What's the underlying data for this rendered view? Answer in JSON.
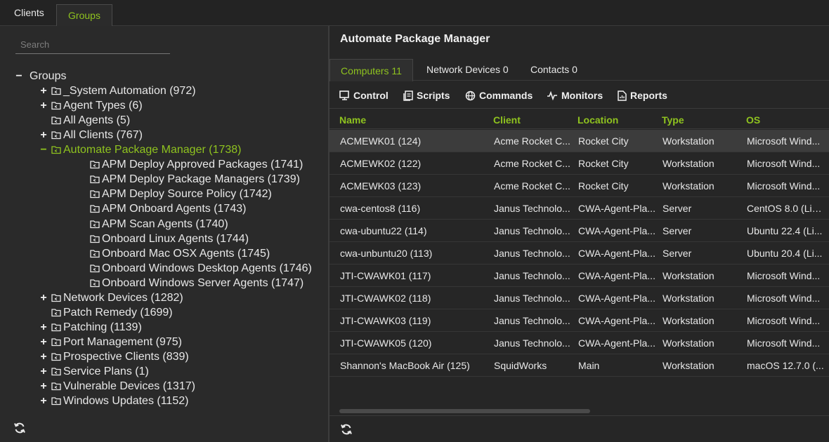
{
  "top_tabs": {
    "clients": "Clients",
    "groups": "Groups"
  },
  "search": {
    "placeholder": "Search",
    "value": ""
  },
  "colors": {
    "accent": "#8fc31f",
    "background": "#2a2a2a",
    "selected_row": "#3c3c3c"
  },
  "tree": {
    "root": {
      "toggle": "−",
      "label": "Groups"
    },
    "items": [
      {
        "toggle": "+",
        "label": "_System Automation (972)"
      },
      {
        "toggle": "+",
        "label": "Agent Types (6)"
      },
      {
        "toggle": "",
        "label": "All Agents (5)"
      },
      {
        "toggle": "+",
        "label": "All Clients (767)"
      },
      {
        "toggle": "−",
        "label": "Automate Package Manager (1738)",
        "selected": true
      },
      {
        "toggle": "",
        "label": "APM Deploy Approved Packages (1741)",
        "child": true
      },
      {
        "toggle": "",
        "label": "APM Deploy Package Managers (1739)",
        "child": true
      },
      {
        "toggle": "",
        "label": "APM Deploy Source Policy (1742)",
        "child": true
      },
      {
        "toggle": "",
        "label": "APM Onboard Agents (1743)",
        "child": true
      },
      {
        "toggle": "",
        "label": "APM Scan Agents (1740)",
        "child": true
      },
      {
        "toggle": "",
        "label": "Onboard Linux Agents (1744)",
        "child": true
      },
      {
        "toggle": "",
        "label": "Onboard Mac OSX Agents (1745)",
        "child": true
      },
      {
        "toggle": "",
        "label": "Onboard Windows Desktop Agents (1746)",
        "child": true
      },
      {
        "toggle": "",
        "label": "Onboard Windows Server Agents (1747)",
        "child": true
      },
      {
        "toggle": "+",
        "label": "Network Devices (1282)"
      },
      {
        "toggle": "",
        "label": "Patch Remedy (1699)"
      },
      {
        "toggle": "+",
        "label": "Patching (1139)"
      },
      {
        "toggle": "+",
        "label": "Port Management (975)"
      },
      {
        "toggle": "+",
        "label": "Prospective Clients (839)"
      },
      {
        "toggle": "+",
        "label": "Service Plans (1)"
      },
      {
        "toggle": "+",
        "label": "Vulnerable Devices (1317)"
      },
      {
        "toggle": "+",
        "label": "Windows Updates (1152)"
      }
    ]
  },
  "right": {
    "title": "Automate Package Manager",
    "tabs": {
      "computers": "Computers 11",
      "network_devices": "Network Devices 0",
      "contacts": "Contacts 0"
    },
    "actions": {
      "control": "Control",
      "scripts": "Scripts",
      "commands": "Commands",
      "monitors": "Monitors",
      "reports": "Reports"
    },
    "columns": [
      "Name",
      "Client",
      "Location",
      "Type",
      "OS"
    ],
    "rows": [
      [
        "ACMEWK01 (124)",
        "Acme Rocket C...",
        "Rocket City",
        "Workstation",
        "Microsoft Wind..."
      ],
      [
        "ACMEWK02 (122)",
        "Acme Rocket C...",
        "Rocket City",
        "Workstation",
        "Microsoft Wind..."
      ],
      [
        "ACMEWK03 (123)",
        "Acme Rocket C...",
        "Rocket City",
        "Workstation",
        "Microsoft Wind..."
      ],
      [
        "cwa-centos8 (116)",
        "Janus Technolo...",
        "CWA-Agent-Pla...",
        "Server",
        "CentOS 8.0 (Lin..."
      ],
      [
        "cwa-ubuntu22 (114)",
        "Janus Technolo...",
        "CWA-Agent-Pla...",
        "Server",
        "Ubuntu 22.4 (Li..."
      ],
      [
        "cwa-unbuntu20 (113)",
        "Janus Technolo...",
        "CWA-Agent-Pla...",
        "Server",
        "Ubuntu 20.4 (Li..."
      ],
      [
        "JTI-CWAWK01 (117)",
        "Janus Technolo...",
        "CWA-Agent-Pla...",
        "Workstation",
        "Microsoft Wind..."
      ],
      [
        "JTI-CWAWK02 (118)",
        "Janus Technolo...",
        "CWA-Agent-Pla...",
        "Workstation",
        "Microsoft Wind..."
      ],
      [
        "JTI-CWAWK03 (119)",
        "Janus Technolo...",
        "CWA-Agent-Pla...",
        "Workstation",
        "Microsoft Wind..."
      ],
      [
        "JTI-CWAWK05 (120)",
        "Janus Technolo...",
        "CWA-Agent-Pla...",
        "Workstation",
        "Microsoft Wind..."
      ],
      [
        "Shannon's MacBook Air (125)",
        "SquidWorks",
        "Main",
        "Workstation",
        "macOS 12.7.0 (..."
      ]
    ]
  }
}
